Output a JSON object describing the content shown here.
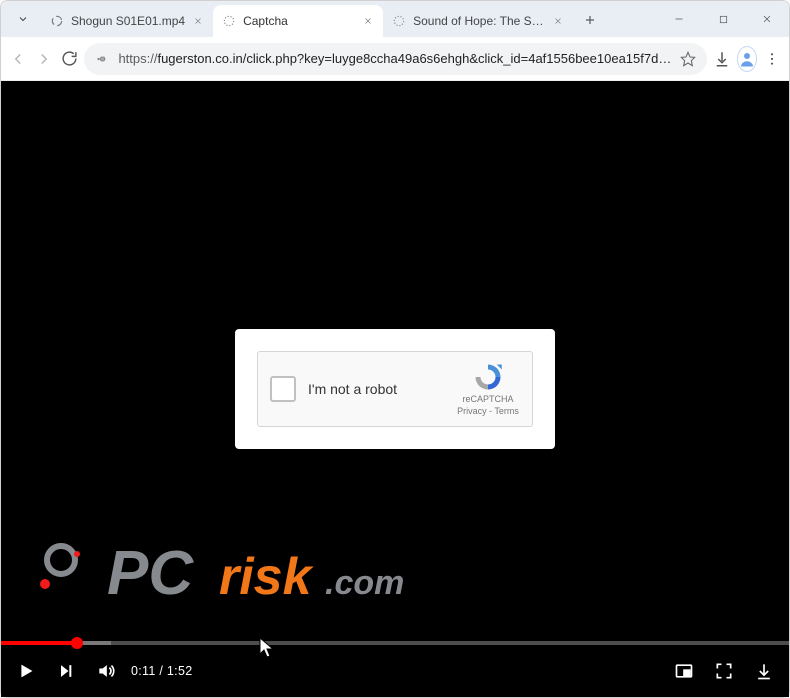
{
  "browser": {
    "tabs": [
      {
        "title": "Shogun S01E01.mp4",
        "favicon": "spinner"
      },
      {
        "title": "Captcha",
        "favicon": "dotted-circle"
      },
      {
        "title": "Sound of Hope: The Story o…",
        "favicon": "dotted-circle"
      }
    ],
    "url_scheme": "https://",
    "url_rest": "fugerston.co.in/click.php?key=luyge8ccha49a6s6ehgh&click_id=4af1556bee10ea15f7d…"
  },
  "captcha": {
    "label": "I'm not a robot",
    "brand": "reCAPTCHA",
    "legal": "Privacy - Terms"
  },
  "player": {
    "time": "0:11 / 1:52",
    "progress_pct": 9.6,
    "buffer_pct": 14
  },
  "watermark": {
    "text": "PCrisk.com"
  }
}
